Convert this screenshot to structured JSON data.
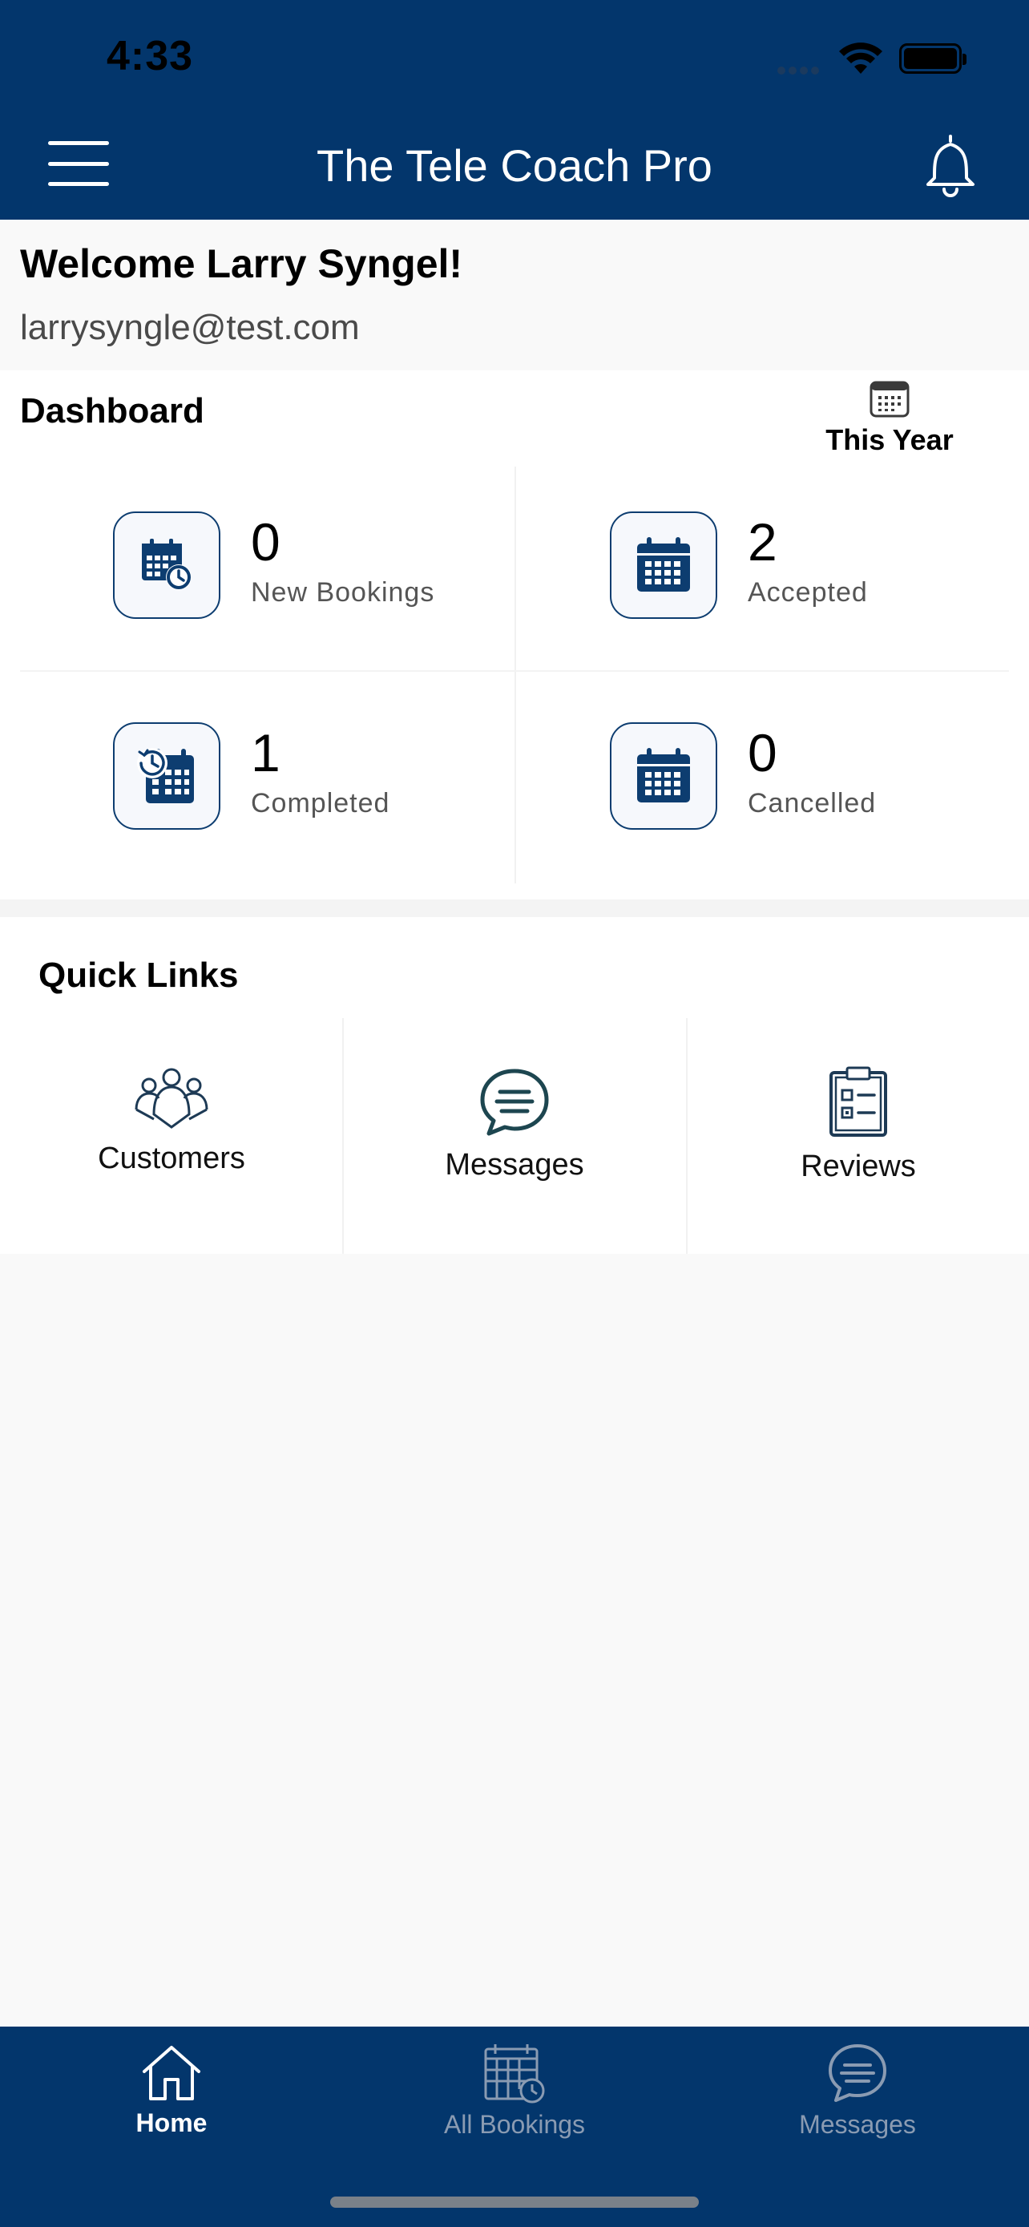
{
  "status_bar": {
    "time": "4:33"
  },
  "header": {
    "title": "The Tele Coach Pro"
  },
  "welcome": {
    "title": "Welcome Larry Syngel!",
    "email": "larrysyngle@test.com"
  },
  "dashboard": {
    "title": "Dashboard",
    "filter_label": "This Year",
    "stats": [
      {
        "value": "0",
        "label": "New Bookings",
        "icon": "calendar-clock-icon"
      },
      {
        "value": "2",
        "label": "Accepted",
        "icon": "calendar-icon"
      },
      {
        "value": "1",
        "label": "Completed",
        "icon": "calendar-history-icon"
      },
      {
        "value": "0",
        "label": "Cancelled",
        "icon": "calendar-icon"
      }
    ]
  },
  "quick_links": {
    "title": "Quick Links",
    "items": [
      {
        "label": "Customers",
        "icon": "customers-icon"
      },
      {
        "label": "Messages",
        "icon": "chat-bubble-icon"
      },
      {
        "label": "Reviews",
        "icon": "clipboard-icon"
      }
    ]
  },
  "tabbar": {
    "tabs": [
      {
        "label": "Home",
        "icon": "home-icon",
        "active": true
      },
      {
        "label": "All Bookings",
        "icon": "bookings-calendar-icon",
        "active": false
      },
      {
        "label": "Messages",
        "icon": "chat-bubble-icon",
        "active": false
      }
    ]
  },
  "colors": {
    "brand": "#03366c",
    "icon": "#0d3d70",
    "inactive_tab": "#8a9bb2"
  }
}
